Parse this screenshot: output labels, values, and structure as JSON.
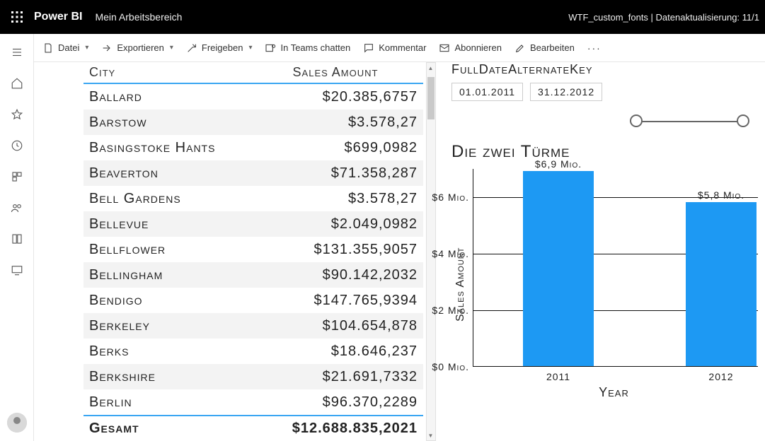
{
  "topbar": {
    "product": "Power BI",
    "workspace": "Mein Arbeitsbereich",
    "right_status": "WTF_custom_fonts  |  Datenaktualisierung: 11/1"
  },
  "toolbar": {
    "file": "Datei",
    "export": "Exportieren",
    "share": "Freigeben",
    "teams": "In Teams chatten",
    "comment": "Kommentar",
    "subscribe": "Abonnieren",
    "edit": "Bearbeiten"
  },
  "leftnav": {
    "icons": [
      "menu-icon",
      "home-icon",
      "star-icon",
      "clock-icon",
      "app-icon",
      "people-icon",
      "book-icon",
      "screen-icon"
    ]
  },
  "table": {
    "headers": {
      "city": "City",
      "amount": "Sales Amount"
    },
    "rows": [
      {
        "city": "Ballard",
        "amount": "$20.385,6757"
      },
      {
        "city": "Barstow",
        "amount": "$3.578,27"
      },
      {
        "city": "Basingstoke Hants",
        "amount": "$699,0982"
      },
      {
        "city": "Beaverton",
        "amount": "$71.358,287"
      },
      {
        "city": "Bell Gardens",
        "amount": "$3.578,27"
      },
      {
        "city": "Bellevue",
        "amount": "$2.049,0982"
      },
      {
        "city": "Bellflower",
        "amount": "$131.355,9057"
      },
      {
        "city": "Bellingham",
        "amount": "$90.142,2032"
      },
      {
        "city": "Bendigo",
        "amount": "$147.765,9394"
      },
      {
        "city": "Berkeley",
        "amount": "$104.654,878"
      },
      {
        "city": "Berks",
        "amount": "$18.646,237"
      },
      {
        "city": "Berkshire",
        "amount": "$21.691,7332"
      },
      {
        "city": "Berlin",
        "amount": "$96.370,2289"
      }
    ],
    "footer": {
      "label": "Gesamt",
      "amount": "$12.688.835,2021"
    }
  },
  "slicer": {
    "title": "FullDateAlternateKey",
    "from": "01.01.2011",
    "to": "31.12.2012"
  },
  "chart_data": {
    "type": "bar",
    "title": "Die zwei Türme",
    "xlabel": "Year",
    "ylabel": "Sales Amount",
    "ylim": [
      0,
      7
    ],
    "yunit": "Mio.",
    "yticks": [
      {
        "v": 0,
        "label": "$0 Mio."
      },
      {
        "v": 2,
        "label": "$2 Mio."
      },
      {
        "v": 4,
        "label": "$4 Mio."
      },
      {
        "v": 6,
        "label": "$6 Mio."
      }
    ],
    "categories": [
      "2011",
      "2012"
    ],
    "values": [
      6.9,
      5.8
    ],
    "value_labels": [
      "$6,9 Mio.",
      "$5,8 Mio."
    ]
  }
}
